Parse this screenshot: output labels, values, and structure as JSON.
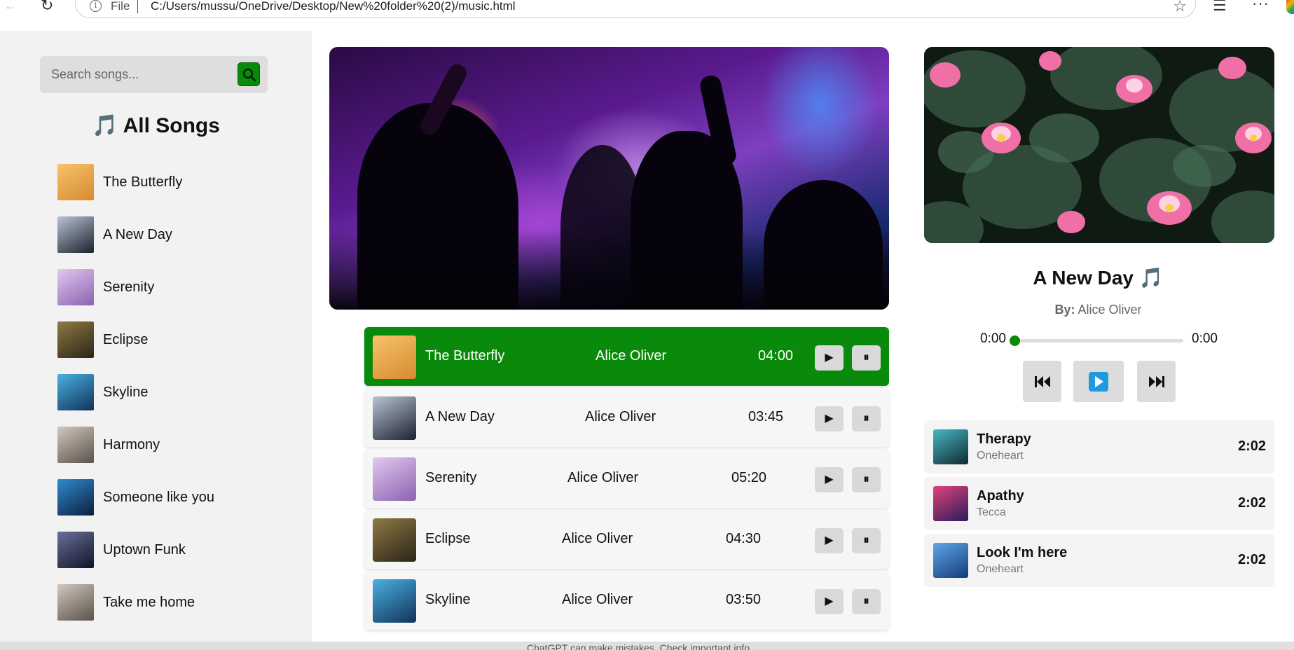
{
  "browser": {
    "file_label": "File",
    "url": "C:/Users/mussu/OneDrive/Desktop/New%20folder%20(2)/music.html"
  },
  "sidebar": {
    "search_placeholder": "Search songs...",
    "title": "🎵 All Songs",
    "songs": [
      {
        "label": "The Butterfly",
        "thumb": [
          "#d78a2f",
          "#f6c36a"
        ]
      },
      {
        "label": "A New Day",
        "thumb": [
          "#1b2230",
          "#b9c3d1"
        ]
      },
      {
        "label": "Serenity",
        "thumb": [
          "#8b62b0",
          "#e2c8ef"
        ]
      },
      {
        "label": "Eclipse",
        "thumb": [
          "#2a2519",
          "#8f7a43"
        ]
      },
      {
        "label": "Skyline",
        "thumb": [
          "#0f3358",
          "#4bb0e3"
        ]
      },
      {
        "label": "Harmony",
        "thumb": [
          "#5a5148",
          "#d2c8bf"
        ]
      },
      {
        "label": "Someone like you",
        "thumb": [
          "#0d1e3e",
          "#2d8cd0"
        ]
      },
      {
        "label": "Uptown Funk",
        "thumb": [
          "#101428",
          "#6a6f9a"
        ]
      },
      {
        "label": "Take me home",
        "thumb": [
          "#5a5148",
          "#d2c8bf"
        ]
      }
    ]
  },
  "playlist": [
    {
      "title": "The Butterfly",
      "artist": "Alice Oliver",
      "duration": "04:00",
      "active": true
    },
    {
      "title": "A New Day",
      "artist": "Alice Oliver",
      "duration": "03:45",
      "active": false
    },
    {
      "title": "Serenity",
      "artist": "Alice Oliver",
      "duration": "05:20",
      "active": false
    },
    {
      "title": "Eclipse",
      "artist": "Alice Oliver",
      "duration": "04:30",
      "active": false
    },
    {
      "title": "Skyline",
      "artist": "Alice Oliver",
      "duration": "03:50",
      "active": false
    }
  ],
  "player": {
    "title": "A New Day 🎵",
    "by_label": "By:",
    "artist": "Alice Oliver",
    "current_time": "0:00",
    "total_time": "0:00",
    "progress": 0
  },
  "recommended": [
    {
      "name": "Therapy",
      "artist": "Oneheart",
      "time": "2:02",
      "thumb": [
        "#0e2a2e",
        "#48b7c6"
      ]
    },
    {
      "name": "Apathy",
      "artist": "Tecca",
      "time": "2:02",
      "thumb": [
        "#2a1b5c",
        "#e0447a"
      ]
    },
    {
      "name": "Look I'm here",
      "artist": "Oneheart",
      "time": "2:02",
      "thumb": [
        "#143a7a",
        "#5fa7e8"
      ]
    }
  ],
  "bottom_notice": "ChatGPT can make mistakes. Check important info.",
  "colors": {
    "accent_green": "#0a8a0a",
    "sidebar_bg": "#f2f2f2",
    "row_bg": "#f6f6f6"
  }
}
